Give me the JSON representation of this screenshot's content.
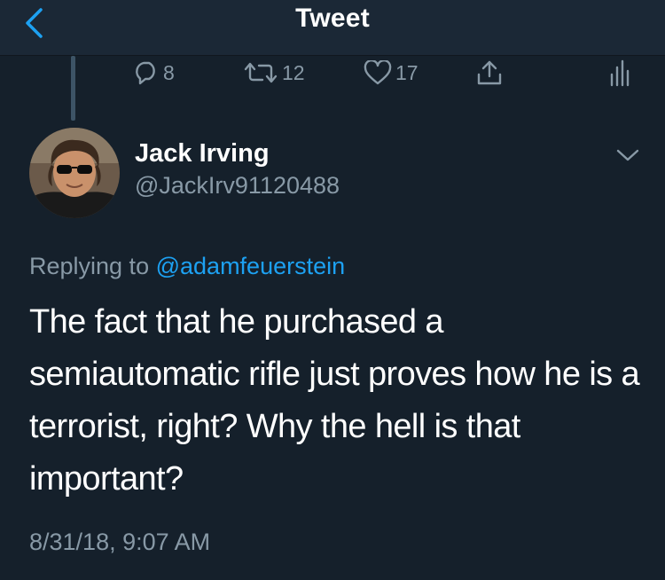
{
  "nav": {
    "title": "Tweet",
    "back_icon": "chevron-left-icon"
  },
  "previous_tweet_actions": {
    "reply_count": "8",
    "retweet_count": "12",
    "like_count": "17",
    "icons": [
      "reply-icon",
      "retweet-icon",
      "like-icon",
      "share-icon",
      "analytics-icon"
    ]
  },
  "tweet": {
    "author_name": "Jack Irving",
    "author_handle": "@JackIrv91120488",
    "replying_prefix": "Replying to",
    "replying_to": "@adamfeuerstein",
    "text": "The fact that he purchased a semiautomatic rifle just proves how he is a terrorist, right? Why the hell is that important?",
    "timestamp": "8/31/18, 9:07 AM"
  },
  "colors": {
    "background": "#15202b",
    "navbar": "#1b2836",
    "secondary_text": "#8899a6",
    "link": "#1da1f2"
  }
}
